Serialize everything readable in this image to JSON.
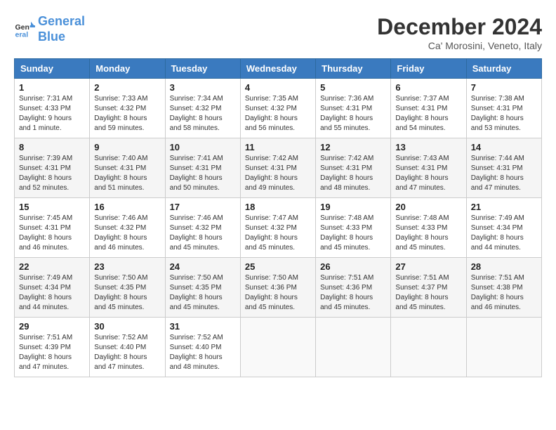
{
  "header": {
    "logo_line1": "General",
    "logo_line2": "Blue",
    "month_title": "December 2024",
    "location": "Ca' Morosini, Veneto, Italy"
  },
  "days_of_week": [
    "Sunday",
    "Monday",
    "Tuesday",
    "Wednesday",
    "Thursday",
    "Friday",
    "Saturday"
  ],
  "weeks": [
    [
      {
        "day": "1",
        "sunrise": "7:31 AM",
        "sunset": "4:33 PM",
        "daylight": "9 hours and 1 minute."
      },
      {
        "day": "2",
        "sunrise": "7:33 AM",
        "sunset": "4:32 PM",
        "daylight": "8 hours and 59 minutes."
      },
      {
        "day": "3",
        "sunrise": "7:34 AM",
        "sunset": "4:32 PM",
        "daylight": "8 hours and 58 minutes."
      },
      {
        "day": "4",
        "sunrise": "7:35 AM",
        "sunset": "4:32 PM",
        "daylight": "8 hours and 56 minutes."
      },
      {
        "day": "5",
        "sunrise": "7:36 AM",
        "sunset": "4:31 PM",
        "daylight": "8 hours and 55 minutes."
      },
      {
        "day": "6",
        "sunrise": "7:37 AM",
        "sunset": "4:31 PM",
        "daylight": "8 hours and 54 minutes."
      },
      {
        "day": "7",
        "sunrise": "7:38 AM",
        "sunset": "4:31 PM",
        "daylight": "8 hours and 53 minutes."
      }
    ],
    [
      {
        "day": "8",
        "sunrise": "7:39 AM",
        "sunset": "4:31 PM",
        "daylight": "8 hours and 52 minutes."
      },
      {
        "day": "9",
        "sunrise": "7:40 AM",
        "sunset": "4:31 PM",
        "daylight": "8 hours and 51 minutes."
      },
      {
        "day": "10",
        "sunrise": "7:41 AM",
        "sunset": "4:31 PM",
        "daylight": "8 hours and 50 minutes."
      },
      {
        "day": "11",
        "sunrise": "7:42 AM",
        "sunset": "4:31 PM",
        "daylight": "8 hours and 49 minutes."
      },
      {
        "day": "12",
        "sunrise": "7:42 AM",
        "sunset": "4:31 PM",
        "daylight": "8 hours and 48 minutes."
      },
      {
        "day": "13",
        "sunrise": "7:43 AM",
        "sunset": "4:31 PM",
        "daylight": "8 hours and 47 minutes."
      },
      {
        "day": "14",
        "sunrise": "7:44 AM",
        "sunset": "4:31 PM",
        "daylight": "8 hours and 47 minutes."
      }
    ],
    [
      {
        "day": "15",
        "sunrise": "7:45 AM",
        "sunset": "4:31 PM",
        "daylight": "8 hours and 46 minutes."
      },
      {
        "day": "16",
        "sunrise": "7:46 AM",
        "sunset": "4:32 PM",
        "daylight": "8 hours and 46 minutes."
      },
      {
        "day": "17",
        "sunrise": "7:46 AM",
        "sunset": "4:32 PM",
        "daylight": "8 hours and 45 minutes."
      },
      {
        "day": "18",
        "sunrise": "7:47 AM",
        "sunset": "4:32 PM",
        "daylight": "8 hours and 45 minutes."
      },
      {
        "day": "19",
        "sunrise": "7:48 AM",
        "sunset": "4:33 PM",
        "daylight": "8 hours and 45 minutes."
      },
      {
        "day": "20",
        "sunrise": "7:48 AM",
        "sunset": "4:33 PM",
        "daylight": "8 hours and 45 minutes."
      },
      {
        "day": "21",
        "sunrise": "7:49 AM",
        "sunset": "4:34 PM",
        "daylight": "8 hours and 44 minutes."
      }
    ],
    [
      {
        "day": "22",
        "sunrise": "7:49 AM",
        "sunset": "4:34 PM",
        "daylight": "8 hours and 44 minutes."
      },
      {
        "day": "23",
        "sunrise": "7:50 AM",
        "sunset": "4:35 PM",
        "daylight": "8 hours and 45 minutes."
      },
      {
        "day": "24",
        "sunrise": "7:50 AM",
        "sunset": "4:35 PM",
        "daylight": "8 hours and 45 minutes."
      },
      {
        "day": "25",
        "sunrise": "7:50 AM",
        "sunset": "4:36 PM",
        "daylight": "8 hours and 45 minutes."
      },
      {
        "day": "26",
        "sunrise": "7:51 AM",
        "sunset": "4:36 PM",
        "daylight": "8 hours and 45 minutes."
      },
      {
        "day": "27",
        "sunrise": "7:51 AM",
        "sunset": "4:37 PM",
        "daylight": "8 hours and 45 minutes."
      },
      {
        "day": "28",
        "sunrise": "7:51 AM",
        "sunset": "4:38 PM",
        "daylight": "8 hours and 46 minutes."
      }
    ],
    [
      {
        "day": "29",
        "sunrise": "7:51 AM",
        "sunset": "4:39 PM",
        "daylight": "8 hours and 47 minutes."
      },
      {
        "day": "30",
        "sunrise": "7:52 AM",
        "sunset": "4:40 PM",
        "daylight": "8 hours and 47 minutes."
      },
      {
        "day": "31",
        "sunrise": "7:52 AM",
        "sunset": "4:40 PM",
        "daylight": "8 hours and 48 minutes."
      },
      null,
      null,
      null,
      null
    ]
  ]
}
